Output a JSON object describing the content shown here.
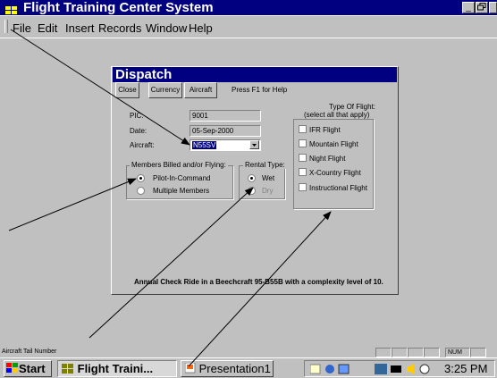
{
  "app": {
    "title": "Flight Training Center System"
  },
  "window_controls": {
    "minimize": "_",
    "restore": "🗗"
  },
  "menu": [
    "File",
    "Edit",
    "Insert",
    "Records",
    "Window",
    "Help"
  ],
  "dispatch": {
    "title": "Dispatch",
    "toolbar": {
      "close": "Close",
      "currency": "Currency",
      "aircraft": "Aircraft",
      "hint": "Press F1 for Help"
    },
    "pic_label": "PIC:",
    "pic_value": "9001",
    "date_label": "Date:",
    "date_value": "05-Sep-2000",
    "aircraft_label": "Aircraft:",
    "aircraft_value": "N55SV",
    "members_group": "Members Billed and/or Flying:",
    "members_options": [
      "Pilot-In-Command",
      "Multiple Members"
    ],
    "rental_group": "Rental Type:",
    "rental_options": [
      "Wet",
      "Dry"
    ],
    "flight_type_title_1": "Type Of Flight:",
    "flight_type_title_2": "(select all that apply)",
    "flight_types": [
      "IFR Flight",
      "Mountain Flight",
      "Night Flight",
      "X-Country Flight",
      "Instructional Flight"
    ],
    "note": "Annual Check Ride in a Beechcraft 95-B55B with a complexity level of 10."
  },
  "status": {
    "text": "Aircraft Tail Number",
    "num": "NUM"
  },
  "taskbar": {
    "start": "Start",
    "app1": "Flight Traini...",
    "app2": "Presentation1",
    "clock": "3:25 PM"
  },
  "colors": {
    "titlebar": "#000080",
    "face": "#c0c0c0"
  }
}
